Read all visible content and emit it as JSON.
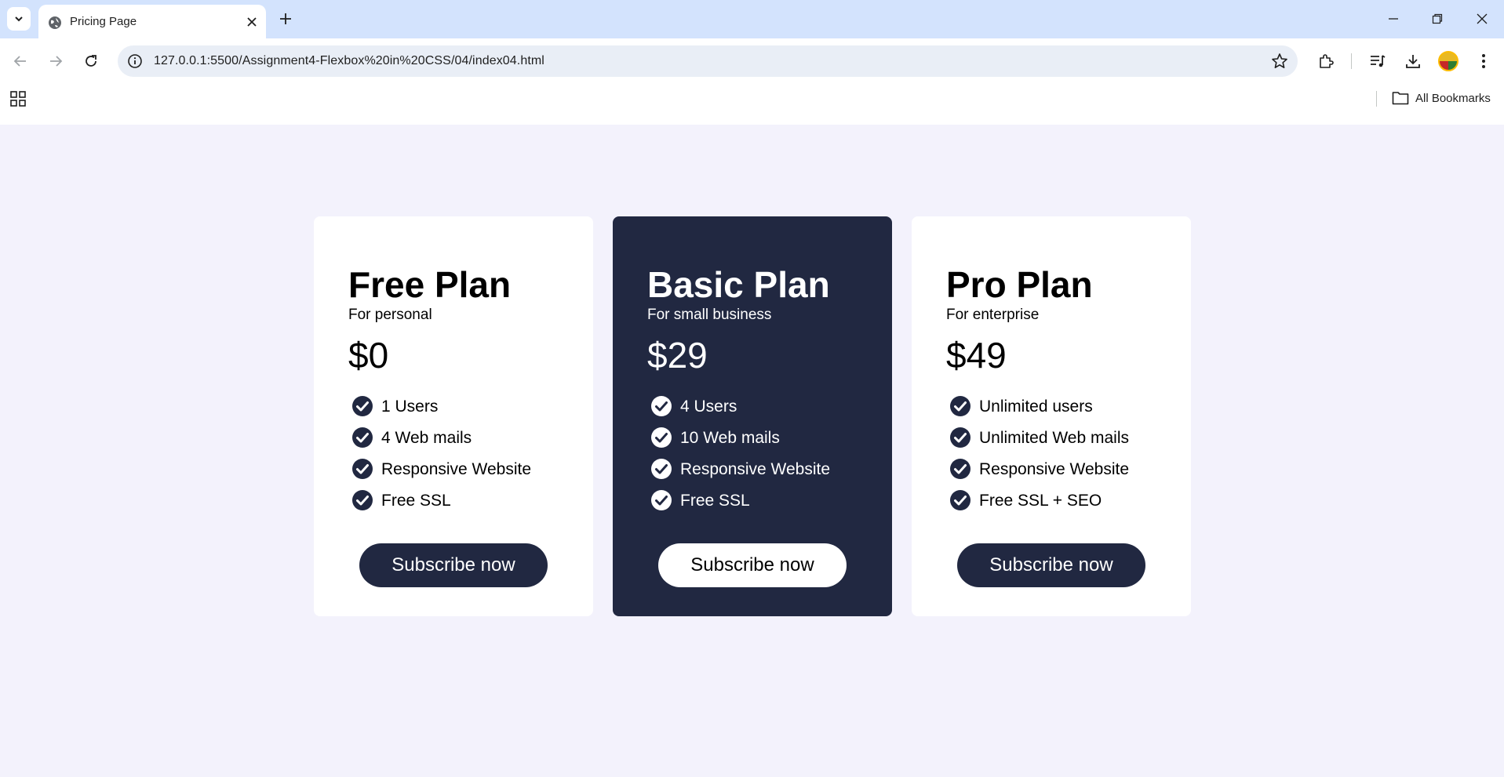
{
  "browser": {
    "tab_title": "Pricing Page",
    "url": "127.0.0.1:5500/Assignment4-Flexbox%20in%20CSS/04/index04.html",
    "bookmarks_label": "All Bookmarks"
  },
  "colors": {
    "page_bg": "#f3f2fc",
    "card_dark": "#212841",
    "card_light": "#ffffff"
  },
  "plans": [
    {
      "title": "Free Plan",
      "subtitle": "For personal",
      "price": "$0",
      "features": [
        "1 Users",
        "4 Web mails",
        "Responsive Website",
        "Free SSL"
      ],
      "button": "Subscribe now"
    },
    {
      "title": "Basic Plan",
      "subtitle": "For small business",
      "price": "$29",
      "features": [
        "4 Users",
        "10 Web mails",
        "Responsive Website",
        "Free SSL"
      ],
      "button": "Subscribe now"
    },
    {
      "title": "Pro Plan",
      "subtitle": "For enterprise",
      "price": "$49",
      "features": [
        "Unlimited users",
        "Unlimited Web mails",
        "Responsive Website",
        "Free SSL + SEO"
      ],
      "button": "Subscribe now"
    }
  ]
}
